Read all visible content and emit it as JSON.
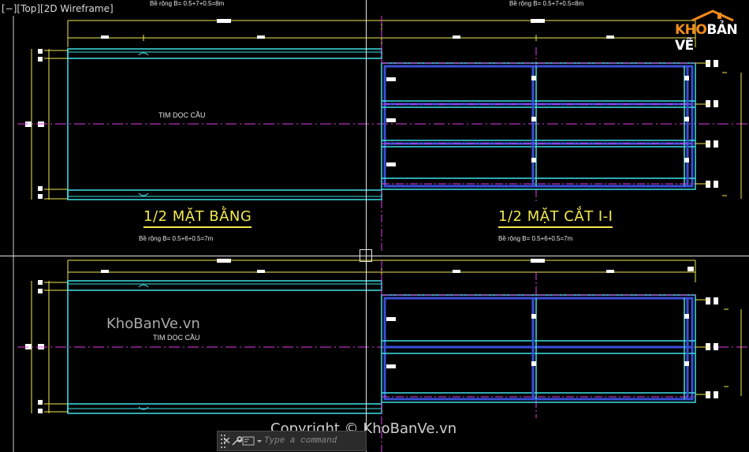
{
  "viewport": {
    "label": "[−][Top][2D Wireframe]"
  },
  "drawing": {
    "top_half": {
      "dim_left": "Bề rộng B= 0.5+7+0.5=8m",
      "dim_right": "Bề rộng B= 0.5+7+0.5=8m",
      "axis_label": "TIM DỌC CẦU",
      "title_left": "1/2 MẶT BẰNG",
      "title_right": "1/2 MẶT CẮT I-I",
      "sub_left": "Bề rộng B= 0.5+6+0.5=7m",
      "sub_right": "Bề rộng B= 0.5+6+0.5=7m"
    },
    "bottom_half": {
      "axis_label": "TIM DỌC CẦU"
    }
  },
  "logo": {
    "prefix": "KHO",
    "suffix": "BẢN VẼ"
  },
  "watermark": "KhoBanVe.vn",
  "copyright": "Copyright © KhoBanVe.vn",
  "command_line": {
    "placeholder": "Type a command",
    "customize_icon": "wrench-icon",
    "prompt_icon": "command-prompt-icon",
    "close_icon": "close-icon"
  },
  "colors": {
    "background": "#000000",
    "cyan": "#3fe0e8",
    "blue": "#3a4fd8",
    "yellow": "#f2e94e",
    "magenta": "#e23be8",
    "white": "#ffffff"
  }
}
